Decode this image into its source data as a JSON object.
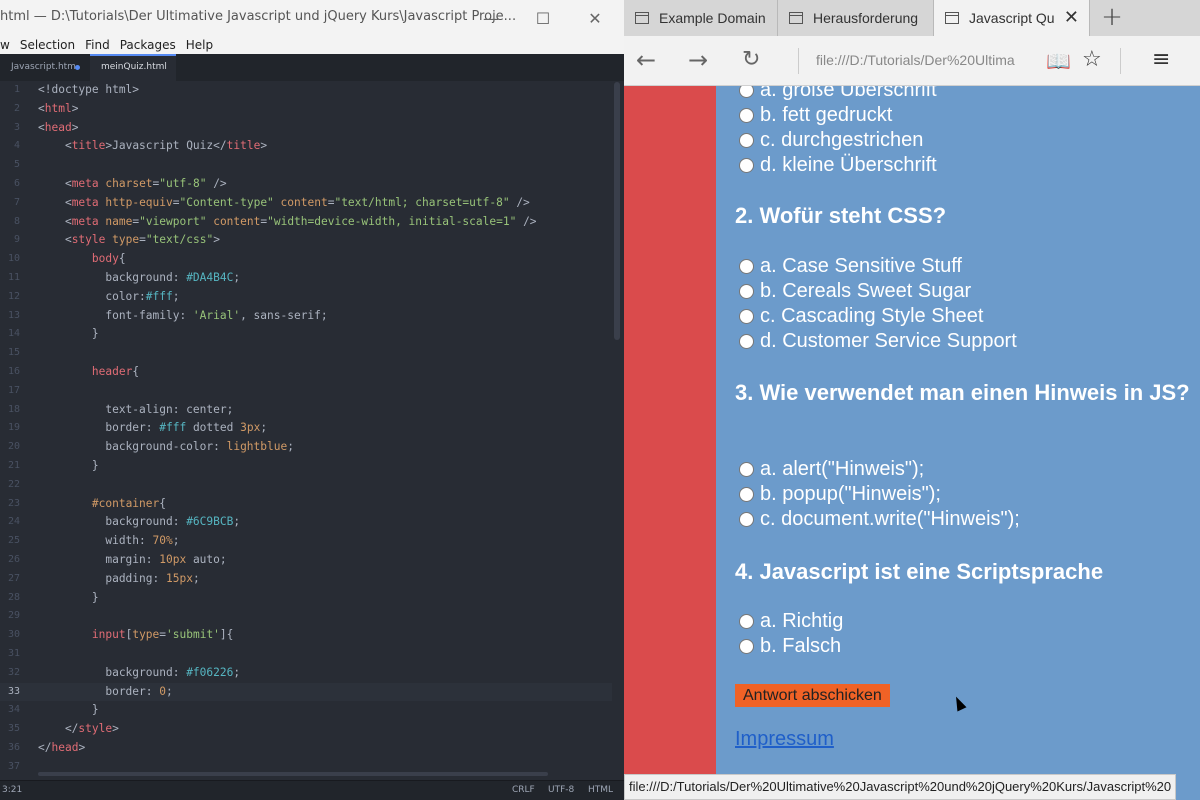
{
  "editor": {
    "title": "html — D:\\Tutorials\\Der Ultimative Javascript und jQuery Kurs\\Javascript Proje...",
    "menu": [
      "w",
      "Selection",
      "Find",
      "Packages",
      "Help"
    ],
    "tabs": [
      {
        "label": "Javascript.htm",
        "modified": true
      },
      {
        "label": "meinQuiz.html",
        "active": true
      }
    ],
    "lines": [
      {
        "n": "1",
        "parts": [
          [
            "p",
            "<!doctype html>"
          ]
        ]
      },
      {
        "n": "2",
        "parts": [
          [
            "p",
            "<"
          ],
          [
            "t",
            "html"
          ],
          [
            "p",
            ">"
          ]
        ]
      },
      {
        "n": "3",
        "parts": [
          [
            "p",
            "<"
          ],
          [
            "t",
            "head"
          ],
          [
            "p",
            ">"
          ]
        ]
      },
      {
        "n": "4",
        "parts": [
          [
            "p",
            "    <"
          ],
          [
            "t",
            "title"
          ],
          [
            "p",
            ">Javascript Quiz</"
          ],
          [
            "t",
            "title"
          ],
          [
            "p",
            ">"
          ]
        ]
      },
      {
        "n": "5",
        "parts": []
      },
      {
        "n": "6",
        "parts": [
          [
            "p",
            "    <"
          ],
          [
            "t",
            "meta"
          ],
          [
            "p",
            " "
          ],
          [
            "a",
            "charset"
          ],
          [
            "p",
            "="
          ],
          [
            "s",
            "\"utf-8\""
          ],
          [
            "p",
            " />"
          ]
        ]
      },
      {
        "n": "7",
        "parts": [
          [
            "p",
            "    <"
          ],
          [
            "t",
            "meta"
          ],
          [
            "p",
            " "
          ],
          [
            "a",
            "http-equiv"
          ],
          [
            "p",
            "="
          ],
          [
            "s",
            "\"Content-type\""
          ],
          [
            "p",
            " "
          ],
          [
            "a",
            "content"
          ],
          [
            "p",
            "="
          ],
          [
            "s",
            "\"text/html; charset=utf-8\""
          ],
          [
            "p",
            " />"
          ]
        ]
      },
      {
        "n": "8",
        "parts": [
          [
            "p",
            "    <"
          ],
          [
            "t",
            "meta"
          ],
          [
            "p",
            " "
          ],
          [
            "a",
            "name"
          ],
          [
            "p",
            "="
          ],
          [
            "s",
            "\"viewport\""
          ],
          [
            "p",
            " "
          ],
          [
            "a",
            "content"
          ],
          [
            "p",
            "="
          ],
          [
            "s",
            "\"width=device-width, initial-scale=1\""
          ],
          [
            "p",
            " />"
          ]
        ]
      },
      {
        "n": "9",
        "parts": [
          [
            "p",
            "    <"
          ],
          [
            "t",
            "style"
          ],
          [
            "p",
            " "
          ],
          [
            "a",
            "type"
          ],
          [
            "p",
            "="
          ],
          [
            "s",
            "\"text/css\""
          ],
          [
            "p",
            ">"
          ]
        ]
      },
      {
        "n": "10",
        "parts": [
          [
            "p",
            "        "
          ],
          [
            "t",
            "body"
          ],
          [
            "p",
            "{"
          ]
        ]
      },
      {
        "n": "11",
        "parts": [
          [
            "p",
            "          background: "
          ],
          [
            "h",
            "#DA4B4C"
          ],
          [
            "p",
            ";"
          ]
        ]
      },
      {
        "n": "12",
        "parts": [
          [
            "p",
            "          color:"
          ],
          [
            "h",
            "#fff"
          ],
          [
            "p",
            ";"
          ]
        ]
      },
      {
        "n": "13",
        "parts": [
          [
            "p",
            "          font-family: "
          ],
          [
            "s",
            "'Arial'"
          ],
          [
            "p",
            ", sans-serif;"
          ]
        ]
      },
      {
        "n": "14",
        "parts": [
          [
            "p",
            "        }"
          ]
        ]
      },
      {
        "n": "15",
        "parts": []
      },
      {
        "n": "16",
        "parts": [
          [
            "p",
            "        "
          ],
          [
            "t",
            "header"
          ],
          [
            "p",
            "{"
          ]
        ]
      },
      {
        "n": "17",
        "parts": []
      },
      {
        "n": "18",
        "parts": [
          [
            "p",
            "          text-align: center;"
          ]
        ]
      },
      {
        "n": "19",
        "parts": [
          [
            "p",
            "          border: "
          ],
          [
            "h",
            "#fff"
          ],
          [
            "p",
            " dotted "
          ],
          [
            "a",
            "3px"
          ],
          [
            "p",
            ";"
          ]
        ]
      },
      {
        "n": "20",
        "parts": [
          [
            "p",
            "          background-color: "
          ],
          [
            "a",
            "lightblue"
          ],
          [
            "p",
            ";"
          ]
        ]
      },
      {
        "n": "21",
        "parts": [
          [
            "p",
            "        }"
          ]
        ]
      },
      {
        "n": "22",
        "parts": []
      },
      {
        "n": "23",
        "parts": [
          [
            "p",
            "        "
          ],
          [
            "a",
            "#container"
          ],
          [
            "p",
            "{"
          ]
        ]
      },
      {
        "n": "24",
        "parts": [
          [
            "p",
            "          background: "
          ],
          [
            "h",
            "#6C9BCB"
          ],
          [
            "p",
            ";"
          ]
        ]
      },
      {
        "n": "25",
        "parts": [
          [
            "p",
            "          width: "
          ],
          [
            "a",
            "70%"
          ],
          [
            "p",
            ";"
          ]
        ]
      },
      {
        "n": "26",
        "parts": [
          [
            "p",
            "          margin: "
          ],
          [
            "a",
            "10px"
          ],
          [
            "p",
            " auto;"
          ]
        ]
      },
      {
        "n": "27",
        "parts": [
          [
            "p",
            "          padding: "
          ],
          [
            "a",
            "15px"
          ],
          [
            "p",
            ";"
          ]
        ]
      },
      {
        "n": "28",
        "parts": [
          [
            "p",
            "        }"
          ]
        ]
      },
      {
        "n": "29",
        "parts": []
      },
      {
        "n": "30",
        "parts": [
          [
            "p",
            "        "
          ],
          [
            "t",
            "input"
          ],
          [
            "p",
            "["
          ],
          [
            "a",
            "type"
          ],
          [
            "p",
            "="
          ],
          [
            "s",
            "'submit'"
          ],
          [
            "p",
            "]{"
          ]
        ]
      },
      {
        "n": "31",
        "parts": []
      },
      {
        "n": "32",
        "parts": [
          [
            "p",
            "          background: "
          ],
          [
            "h",
            "#f06226"
          ],
          [
            "p",
            ";"
          ]
        ]
      },
      {
        "n": "33",
        "parts": [
          [
            "p",
            "          border: "
          ],
          [
            "a",
            "0"
          ],
          [
            "p",
            ";"
          ]
        ],
        "current": true
      },
      {
        "n": "34",
        "parts": [
          [
            "p",
            "        }"
          ]
        ]
      },
      {
        "n": "35",
        "parts": [
          [
            "p",
            "    </"
          ],
          [
            "t",
            "style"
          ],
          [
            "p",
            ">"
          ]
        ]
      },
      {
        "n": "36",
        "parts": [
          [
            "p",
            "</"
          ],
          [
            "t",
            "head"
          ],
          [
            "p",
            ">"
          ]
        ]
      },
      {
        "n": "37",
        "parts": []
      }
    ],
    "status": {
      "position": "3:21",
      "line_ending": "CRLF",
      "encoding": "UTF-8",
      "grammar": "HTML"
    }
  },
  "browser": {
    "tabs": [
      {
        "label": "Example Domain"
      },
      {
        "label": "Herausforderung"
      },
      {
        "label": "Javascript Qu",
        "active": true
      }
    ],
    "address": "file:///D:/Tutorials/Der%20Ultima",
    "page": {
      "questions": [
        {
          "title": "",
          "options": [
            "a. große Überschrift",
            "b. fett gedruckt",
            "c. durchgestrichen",
            "d. kleine Überschrift"
          ]
        },
        {
          "title": "2. Wofür steht CSS?",
          "options": [
            "a. Case Sensitive Stuff",
            "b. Cereals Sweet Sugar",
            "c. Cascading Style Sheet",
            "d. Customer Service Support"
          ]
        },
        {
          "title": "3. Wie verwendet man einen Hinweis in JS?",
          "options": [
            "a. alert(\"Hinweis\");",
            "b. popup(\"Hinweis\");",
            "c. document.write(\"Hinweis\");"
          ]
        },
        {
          "title": "4. Javascript ist eine Scriptsprache",
          "options": [
            "a. Richtig",
            "b. Falsch"
          ]
        }
      ],
      "submit_label": "Antwort abschicken",
      "link_label": "Impressum"
    },
    "status_url": "file:///D:/Tutorials/Der%20Ultimative%20Javascript%20und%20jQuery%20Kurs/Javascript%20",
    "colors": {
      "page_bg": "#DA4B4C",
      "container_bg": "#6C9BCB",
      "submit_bg": "#f06226"
    }
  }
}
